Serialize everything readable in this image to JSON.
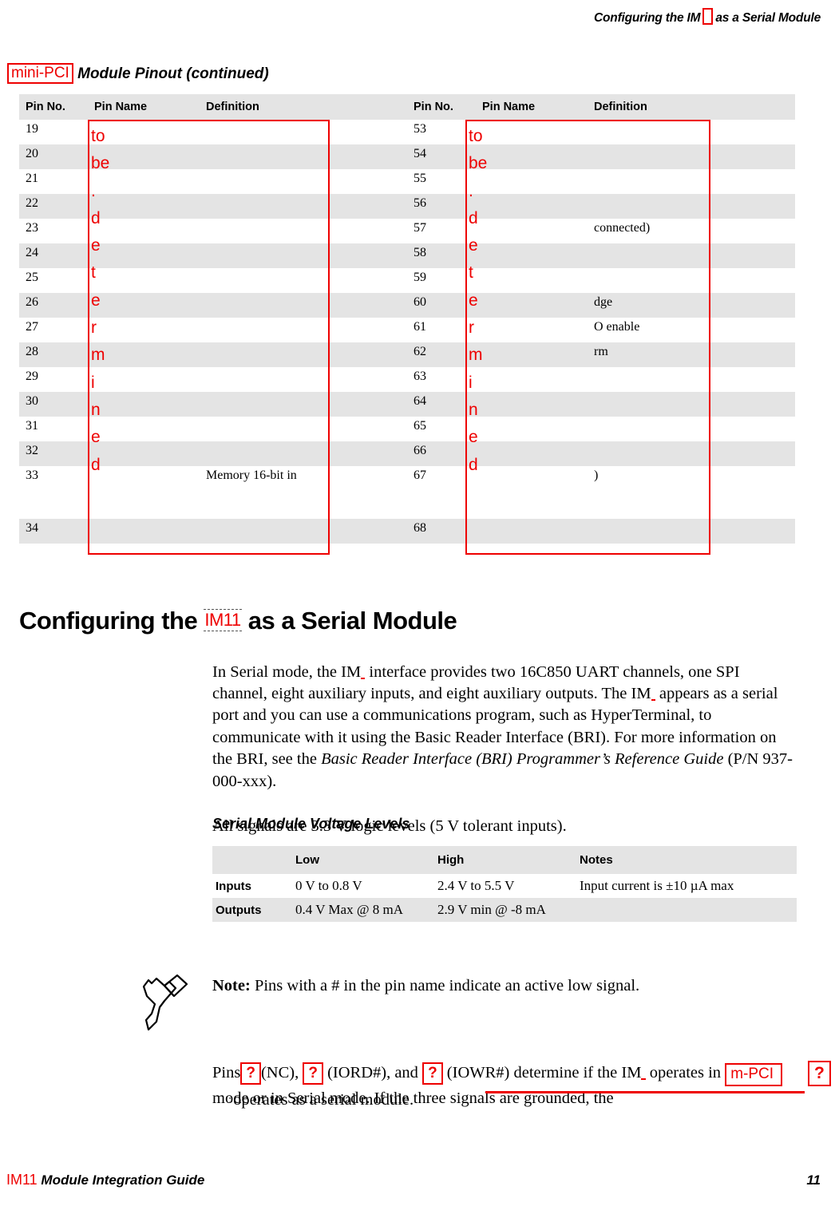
{
  "page": {
    "running_header_before": "Configuring the IM",
    "running_header_after": "as a Serial Module",
    "footer_brand": "IM11",
    "footer_title": "Module Integration Guide",
    "page_number": "11"
  },
  "pinout": {
    "caption_annotation": "mini-PCI",
    "caption": "Module Pinout (continued)",
    "headers": [
      "Pin No.",
      "Pin Name",
      "Definition",
      "Pin No.",
      "Pin Name",
      "Definition"
    ],
    "rows": [
      {
        "left_pin": "19",
        "left_name": "",
        "left_def": "",
        "right_pin": "53",
        "right_name": "",
        "right_def": ""
      },
      {
        "left_pin": "20",
        "left_name": "",
        "left_def": "",
        "right_pin": "54",
        "right_name": "",
        "right_def": ""
      },
      {
        "left_pin": "21",
        "left_name": "",
        "left_def": "",
        "right_pin": "55",
        "right_name": "",
        "right_def": ""
      },
      {
        "left_pin": "22",
        "left_name": "",
        "left_def": "",
        "right_pin": "56",
        "right_name": "",
        "right_def": ""
      },
      {
        "left_pin": "23",
        "left_name": "",
        "left_def": "",
        "right_pin": "57",
        "right_name": "",
        "right_def": "connected)"
      },
      {
        "left_pin": "24",
        "left_name": "",
        "left_def": "",
        "right_pin": "58",
        "right_name": "",
        "right_def": ""
      },
      {
        "left_pin": "25",
        "left_name": "",
        "left_def": "",
        "right_pin": "59",
        "right_name": "",
        "right_def": ""
      },
      {
        "left_pin": "26",
        "left_name": "",
        "left_def": "",
        "right_pin": "60",
        "right_name": "",
        "right_def": "dge"
      },
      {
        "left_pin": "27",
        "left_name": "",
        "left_def": "",
        "right_pin": "61",
        "right_name": "",
        "right_def": "O enable"
      },
      {
        "left_pin": "28",
        "left_name": "",
        "left_def": "",
        "right_pin": "62",
        "right_name": "",
        "right_def": "rm"
      },
      {
        "left_pin": "29",
        "left_name": "",
        "left_def": "",
        "right_pin": "63",
        "right_name": "",
        "right_def": ""
      },
      {
        "left_pin": "30",
        "left_name": "",
        "left_def": "",
        "right_pin": "64",
        "right_name": "",
        "right_def": ""
      },
      {
        "left_pin": "31",
        "left_name": "",
        "left_def": "",
        "right_pin": "65",
        "right_name": "",
        "right_def": ""
      },
      {
        "left_pin": "32",
        "left_name": "",
        "left_def": "",
        "right_pin": "66",
        "right_name": "",
        "right_def": ""
      },
      {
        "left_pin": "33",
        "left_name": "",
        "left_def": "Memory 16-bit in",
        "right_pin": "67",
        "right_name": "",
        "right_def": ")"
      },
      {
        "left_pin": "34",
        "left_name": "",
        "left_def": "",
        "right_pin": "68",
        "right_name": "",
        "right_def": ""
      }
    ],
    "redaction_note": "to be determined",
    "redaction_lines": [
      "to",
      "be",
      ".",
      "d",
      "e",
      "t",
      "e",
      "r",
      "m",
      "i",
      "n",
      "e",
      "d"
    ]
  },
  "section": {
    "heading_before": "Configuring the ",
    "heading_annotation": "IM11",
    "heading_after": " as a Serial Module",
    "intro_p1": "In Serial mode, the IM",
    "intro_p2": " interface provides two 16C850 UART channels, one SPI channel, eight auxiliary inputs, and eight auxiliary outputs. The IM",
    "intro_p3": " appears as a serial port and you can use a communications program, such as HyperTerminal, to communicate with it using the Basic Reader Interface (BRI). For more information on the BRI, see the ",
    "intro_italic": "Basic Reader Interface (BRI) Programmer’s Reference Guide",
    "intro_p4": " (P/N 937-000-xxx).",
    "signals_para": "All signals are 3.3 V logic levels (5 V tolerant inputs)."
  },
  "voltage": {
    "caption": "Serial Module Voltage Levels",
    "headers": [
      "",
      "Low",
      "High",
      "Notes"
    ],
    "rows": [
      {
        "label": "Inputs",
        "low": "0 V to 0.8 V",
        "high": "2.4 V to 5.5 V",
        "notes": "Input current is ±10 µA max"
      },
      {
        "label": "Outputs",
        "low": "0.4 V Max @ 8 mA",
        "high": "2.9 V min @ -8 mA",
        "notes": ""
      }
    ]
  },
  "note": {
    "icon": "pencil-note-icon",
    "label": "Note:",
    "text": " Pins with a # in the pin name indicate an active low signal."
  },
  "final": {
    "t1": "Pins",
    "q1": "?",
    "t2": "(NC), ",
    "q2": "?",
    "t3": " (IORD#), and ",
    "q3": "?",
    "t4": " (IOWR#) determine if the IM",
    "t5": " operates in ",
    "mpci": "m-PCI",
    "t6": " mode or in Serial mode. If the three signals are grounded, the",
    "q4": "?",
    "last_line": "operates as a serial module.",
    "colon_mark": ":"
  },
  "colors": {
    "annotation_red": "#ee0000",
    "table_band": "#e4e4e4",
    "text": "#000000"
  }
}
